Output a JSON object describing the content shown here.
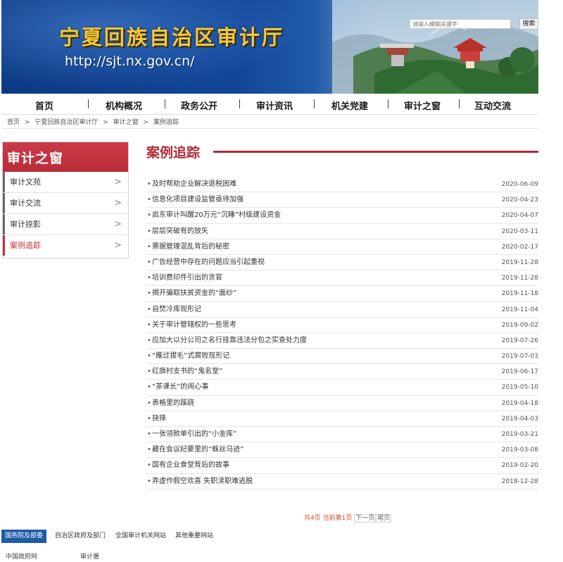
{
  "header": {
    "title": "宁夏回族自治区审计厅",
    "url": "http://sjt.nx.gov.cn/",
    "search_placeholder": "请输入模糊关键字",
    "search_button": "搜索"
  },
  "nav": [
    "首页",
    "机构概况",
    "政务公开",
    "审计资讯",
    "机关党建",
    "审计之窗",
    "互动交流"
  ],
  "breadcrumb": [
    "首页",
    ">",
    "宁夏回族自治区审计厅",
    ">",
    "审计之窗",
    ">",
    "案例追踪"
  ],
  "sidebar": {
    "title": "审计之窗",
    "items": [
      "审计文苑",
      "审计交流",
      "审计掠影",
      "案例追踪"
    ],
    "active_index": 3
  },
  "main": {
    "title": "案例追踪",
    "articles": [
      {
        "title": "及时帮助企业解决退税困难",
        "date": "2020-06-09"
      },
      {
        "title": "信息化项目建设监管亟待加强",
        "date": "2020-04-23"
      },
      {
        "title": "启东审计叫醒20万元“沉睡”村级建设资金",
        "date": "2020-04-07"
      },
      {
        "title": "层层突破有的放矢",
        "date": "2020-03-11"
      },
      {
        "title": "票据管理混乱背后的秘密",
        "date": "2020-02-17"
      },
      {
        "title": "广告经营中存在的问题应当引起重视",
        "date": "2019-11-28"
      },
      {
        "title": "培训费印件引出的贪官",
        "date": "2019-11-28"
      },
      {
        "title": "揭开骗取扶贫资金的“面纱”",
        "date": "2019-11-18"
      },
      {
        "title": "自焚冷库现形记",
        "date": "2019-11-04"
      },
      {
        "title": "关于审计管辖权的一些思考",
        "date": "2019-09-02"
      },
      {
        "title": "应加大以分公司之名行挂靠违法分包之实查处力度",
        "date": "2019-07-26"
      },
      {
        "title": "“雁过拔毛”式腐败现形记",
        "date": "2019-07-03"
      },
      {
        "title": "红旗村支书的“鬼名堂”",
        "date": "2019-06-17"
      },
      {
        "title": "“茶课长”的闹心事",
        "date": "2019-05-10"
      },
      {
        "title": "表格里的蹊跷",
        "date": "2019-04-18"
      },
      {
        "title": "抉择",
        "date": "2019-04-03"
      },
      {
        "title": "一张领款单引出的“小金库”",
        "date": "2019-03-21"
      },
      {
        "title": "藏在会议纪要里的“蛛丝马迹”",
        "date": "2019-03-08"
      },
      {
        "title": "国有企业食堂背后的故事",
        "date": "2019-02-20"
      },
      {
        "title": "弄虚作假空欢喜 失职渎职难逃脱",
        "date": "2018-12-28"
      }
    ]
  },
  "pager": {
    "total": "共4页",
    "current": "当前第1页",
    "next": "下一页",
    "last": "尾页"
  },
  "footer": {
    "tabs": [
      "国务院及部委",
      "自治区政府及部门",
      "全国审计机关网站",
      "其他重要网站"
    ],
    "links": [
      "中国政府网",
      "审计署"
    ]
  },
  "colors": {
    "banner_blue": "#13479a",
    "accent_red": "#b02a37",
    "title_gold": "#f5c73a"
  }
}
